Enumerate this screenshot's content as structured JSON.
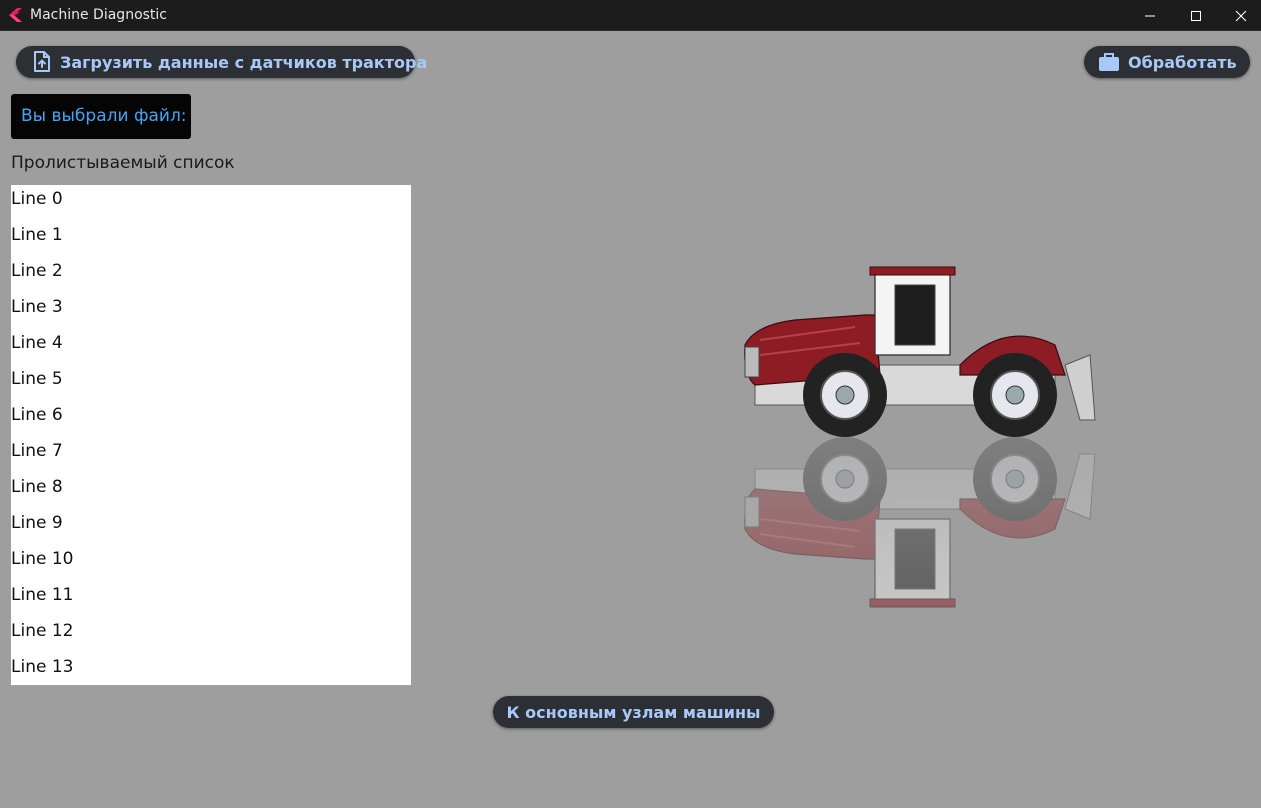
{
  "window": {
    "title": "Machine Diagnostic"
  },
  "toolbar": {
    "upload_label": "Загрузить данные с датчиков трактора",
    "process_label": "Обработать"
  },
  "file": {
    "selected_label": "Вы выбрали файл:"
  },
  "list": {
    "label": "Пролистываемый список",
    "items": [
      "Line 0",
      "Line 1",
      "Line 2",
      "Line 3",
      "Line 4",
      "Line 5",
      "Line 6",
      "Line 7",
      "Line 8",
      "Line 9",
      "Line 10",
      "Line 11",
      "Line 12",
      "Line 13"
    ]
  },
  "footer": {
    "units_label": "К основным узлам машины"
  },
  "icons": {
    "app": "flutter-logo-icon",
    "upload": "file-upload-icon",
    "process": "briefcase-icon",
    "minimize": "minimize-icon",
    "maximize": "maximize-icon",
    "close": "close-icon"
  },
  "colors": {
    "background": "#9e9e9e",
    "titlebar": "#1c1c1c",
    "button_bg": "#2c3035",
    "button_text": "#a8c8f8",
    "file_text": "#42a5f5",
    "tractor_red": "#8e1c24"
  }
}
